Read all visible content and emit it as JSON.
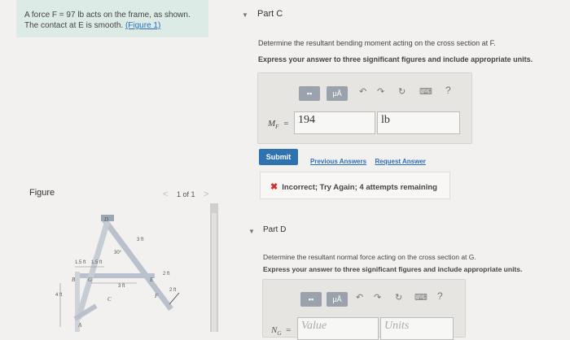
{
  "problem": {
    "line1": "A force F = 97 lb acts on the frame, as shown.",
    "line2_prefix": "The contact at E is smooth.",
    "figure_link": "(Figure 1)"
  },
  "figure": {
    "label": "Figure",
    "pager": "1 of 1",
    "dims": {
      "d1": "1.5 ft",
      "d2": "1.5 ft",
      "d3": "3 ft",
      "d4": "3 ft",
      "d5": "2 ft",
      "d6": "2 ft",
      "d7": "4 ft",
      "angle": "30°"
    },
    "points": {
      "A": "A",
      "B": "B",
      "C": "C",
      "D": "D",
      "E": "E",
      "F": "F",
      "G": "G"
    }
  },
  "partC": {
    "title": "Part C",
    "question": "Determine the resultant bending moment acting on the cross section at F.",
    "instruction": "Express your answer to three significant figures and include appropriate units.",
    "var_label": "M",
    "var_sub": "F",
    "equals": "=",
    "value": "194",
    "units": "lb",
    "submit": "Submit",
    "prev_answers": "Previous Answers",
    "request_answer": "Request Answer",
    "feedback": "Incorrect; Try Again; 4 attempts remaining"
  },
  "partD": {
    "title": "Part D",
    "question": "Determine the resultant normal force acting on the cross section at G.",
    "instruction": "Express your answer to three significant figures and include appropriate units.",
    "var_label": "N",
    "var_sub": "G",
    "equals": "=",
    "value_placeholder": "Value",
    "units_placeholder": "Units"
  },
  "toolbar": {
    "mu_label": "μÅ",
    "help": "?"
  }
}
